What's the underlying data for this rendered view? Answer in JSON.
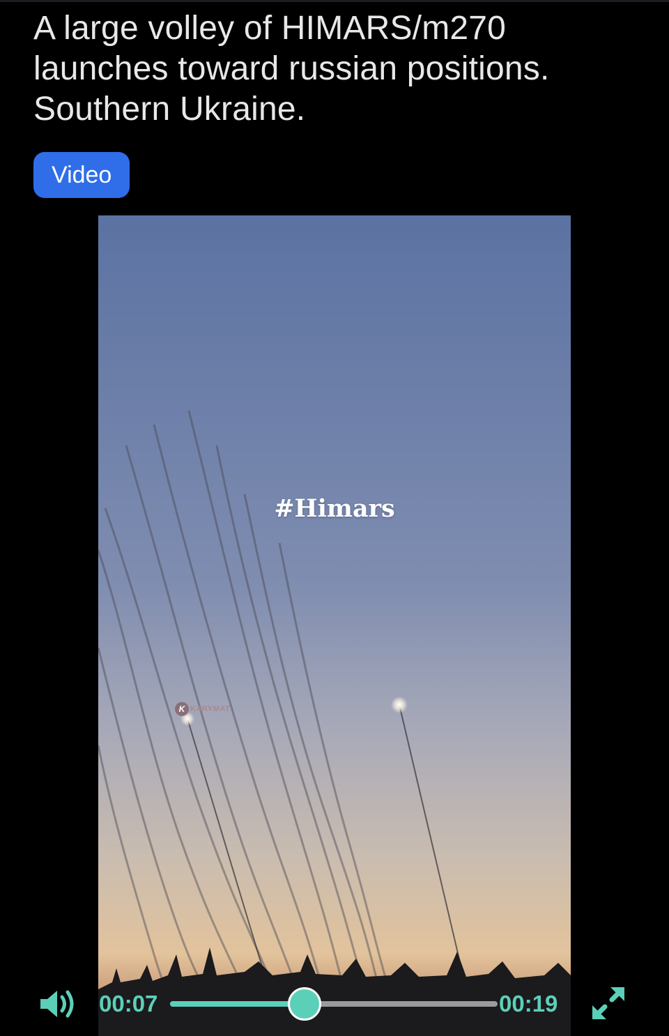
{
  "post": {
    "title": "A large volley of HIMARS/m270 launches toward russian positions. Southern Ukraine.",
    "flair": "Video"
  },
  "video": {
    "overlay_text": "#Himars",
    "watermark_text": "KARYMAT",
    "watermark_logo_letter": "K"
  },
  "player": {
    "current_time": "00:07",
    "total_time": "00:19",
    "progress": 0.41,
    "accent_color": "#5ccfb9",
    "volume_icon": "speaker-icon",
    "fullscreen_icon": "expand-icon"
  },
  "colors": {
    "flair_background": "#2f6ee8",
    "page_background": "#000000"
  }
}
